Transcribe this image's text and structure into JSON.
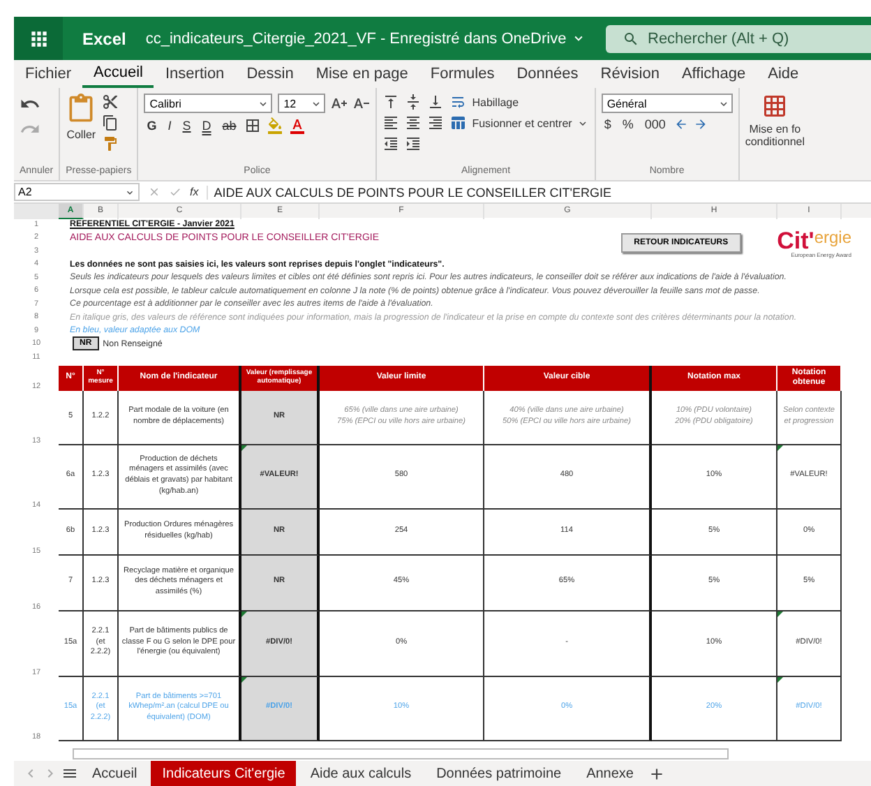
{
  "app": {
    "name": "Excel",
    "file_title": "cc_indicateurs_Citergie_2021_VF",
    "title_separator": "-",
    "save_status": "Enregistré dans OneDrive"
  },
  "search": {
    "placeholder": "Rechercher (Alt + Q)"
  },
  "menu": [
    {
      "label": "Fichier",
      "selected": false
    },
    {
      "label": "Accueil",
      "selected": true
    },
    {
      "label": "Insertion",
      "selected": false
    },
    {
      "label": "Dessin",
      "selected": false
    },
    {
      "label": "Mise en page",
      "selected": false
    },
    {
      "label": "Formules",
      "selected": false
    },
    {
      "label": "Données",
      "selected": false
    },
    {
      "label": "Révision",
      "selected": false
    },
    {
      "label": "Affichage",
      "selected": false
    },
    {
      "label": "Aide",
      "selected": false
    }
  ],
  "ribbon": {
    "groups": [
      "Annuler",
      "Presse-papiers",
      "Police",
      "Alignement",
      "Nombre"
    ],
    "paste_label": "Coller",
    "font_name": "Calibri",
    "font_size": "12",
    "font_styles": [
      "G",
      "I",
      "S",
      "D",
      "ab"
    ],
    "wrap_label": "Habillage",
    "merge_label": "Fusionner et centrer",
    "number_format": "Général",
    "number_buttons": [
      "$",
      "%",
      "000"
    ],
    "conditional_format": [
      "Mise en fo",
      "conditionnel"
    ]
  },
  "formula_bar": {
    "name_box": "A2",
    "fx": "fx",
    "value": "AIDE AUX CALCULS DE POINTS POUR LE CONSEILLER CIT'ERGIE"
  },
  "columns": [
    {
      "label": "A",
      "selected": true
    },
    {
      "label": "B",
      "selected": false
    },
    {
      "label": "C",
      "selected": false
    },
    {
      "label": "E",
      "selected": false
    },
    {
      "label": "F",
      "selected": false
    },
    {
      "label": "G",
      "selected": false
    },
    {
      "label": "H",
      "selected": false
    },
    {
      "label": "I",
      "selected": false
    }
  ],
  "notes": [
    {
      "row": "1",
      "kind": "title",
      "text": "REFERENTIEL CIT'ERGIE - Janvier 2021"
    },
    {
      "row": "2",
      "kind": "subtitle",
      "text": "AIDE AUX CALCULS DE POINTS POUR LE CONSEILLER CIT'ERGIE"
    },
    {
      "row": "3",
      "kind": "blank"
    },
    {
      "row": "4",
      "kind": "bold",
      "text": "Les données ne sont pas saisies ici, les valeurs sont reprises depuis l'onglet \"indicateurs\"."
    },
    {
      "row": "5",
      "kind": "italic",
      "text": "Seuls les indicateurs pour lesquels des valeurs limites et cibles ont été définies sont repris ici. Pour les autres indicateurs, le conseiller doit se référer aux indications de l'aide à l'évaluation."
    },
    {
      "row": "6",
      "kind": "italic",
      "text": "Lorsque cela est possible, le tableur calcule automatiquement en colonne J la note (% de points) obtenue grâce à l'indicateur. Vous pouvez déverouiller la feuille sans mot de passe."
    },
    {
      "row": "7",
      "kind": "italic",
      "text": "Ce pourcentage est à additionner par le conseiller avec les autres  items de l'aide à l'évaluation."
    },
    {
      "row": "8",
      "kind": "grey",
      "text": "En italique gris, des valeurs de référence sont indiquées pour information, mais la progression de l'indicateur et la prise en compte du contexte sont des critères déterminants pour la notation."
    },
    {
      "row": "9",
      "kind": "blue",
      "text": "En bleu, valeur  adaptée aux DOM"
    },
    {
      "row": "10",
      "kind": "legend",
      "badge": "NR",
      "text": "Non Renseigné"
    },
    {
      "row": "11",
      "kind": "blank"
    }
  ],
  "return_button": "RETOUR INDICATEURS",
  "logo": {
    "main": "Cit'",
    "accent": "ergie",
    "tagline": "European Energy Award"
  },
  "table": {
    "row": "12",
    "headers": [
      "N°",
      "N° mesure",
      "Nom de l'indicateur",
      "Valeur (remplissage automatique)",
      "Valeur limite",
      "Valeur cible",
      "Notation max",
      "Notation obtenue"
    ],
    "rows": [
      {
        "row": "13",
        "kind": "reference",
        "value_flag": false,
        "score_flag": false,
        "cells": [
          "5",
          "1.2.2",
          "Part modale de la voiture (en nombre de déplacements)",
          "NR",
          "65% (ville dans une aire urbaine)\n75% (EPCI ou ville hors aire urbaine)",
          "40% (ville dans une aire urbaine)\n50% (EPCI ou ville hors aire urbaine)",
          "10% (PDU volontaire)\n20% (PDU obligatoire)",
          "Selon contexte et progression"
        ]
      },
      {
        "row": "14",
        "kind": "standard",
        "value_flag": true,
        "score_flag": true,
        "cells": [
          "6a",
          "1.2.3",
          "Production de déchets ménagers et assimilés (avec déblais et gravats) par habitant (kg/hab.an)",
          "#VALEUR!",
          "580",
          "480",
          "10%",
          "#VALEUR!"
        ]
      },
      {
        "row": "15",
        "kind": "standard",
        "value_flag": false,
        "score_flag": false,
        "cells": [
          "6b",
          "1.2.3",
          "Production Ordures ménagères résiduelles (kg/hab)",
          "NR",
          "254",
          "114",
          "5%",
          "0%"
        ]
      },
      {
        "row": "16",
        "kind": "standard",
        "value_flag": false,
        "score_flag": false,
        "cells": [
          "7",
          "1.2.3",
          "Recyclage matière et organique des déchets ménagers et assimilés (%)",
          "NR",
          "45%",
          "65%",
          "5%",
          "5%"
        ]
      },
      {
        "row": "17",
        "kind": "standard",
        "value_flag": true,
        "score_flag": true,
        "cells": [
          "15a",
          "2.2.1 (et 2.2.2)",
          "Part de bâtiments publics de classe F ou G selon le DPE pour l'énergie (ou équivalent)",
          "#DIV/0!",
          "0%",
          "-",
          "10%",
          "#DIV/0!"
        ]
      },
      {
        "row": "18",
        "kind": "dom",
        "value_flag": true,
        "score_flag": true,
        "cells": [
          "15a",
          "2.2.1 (et 2.2.2)",
          "Part de bâtiments >=701 kWhep/m².an (calcul DPE ou équivalent) (DOM)",
          "#DIV/0!",
          "10%",
          "0%",
          "20%",
          "#DIV/0!"
        ]
      }
    ]
  },
  "sheet_tabs": [
    {
      "label": "Accueil",
      "selected": false
    },
    {
      "label": "Indicateurs Cit'ergie",
      "selected": true
    },
    {
      "label": "Aide aux calculs",
      "selected": false
    },
    {
      "label": "Données patrimoine",
      "selected": false
    },
    {
      "label": "Annexe",
      "selected": false
    }
  ]
}
